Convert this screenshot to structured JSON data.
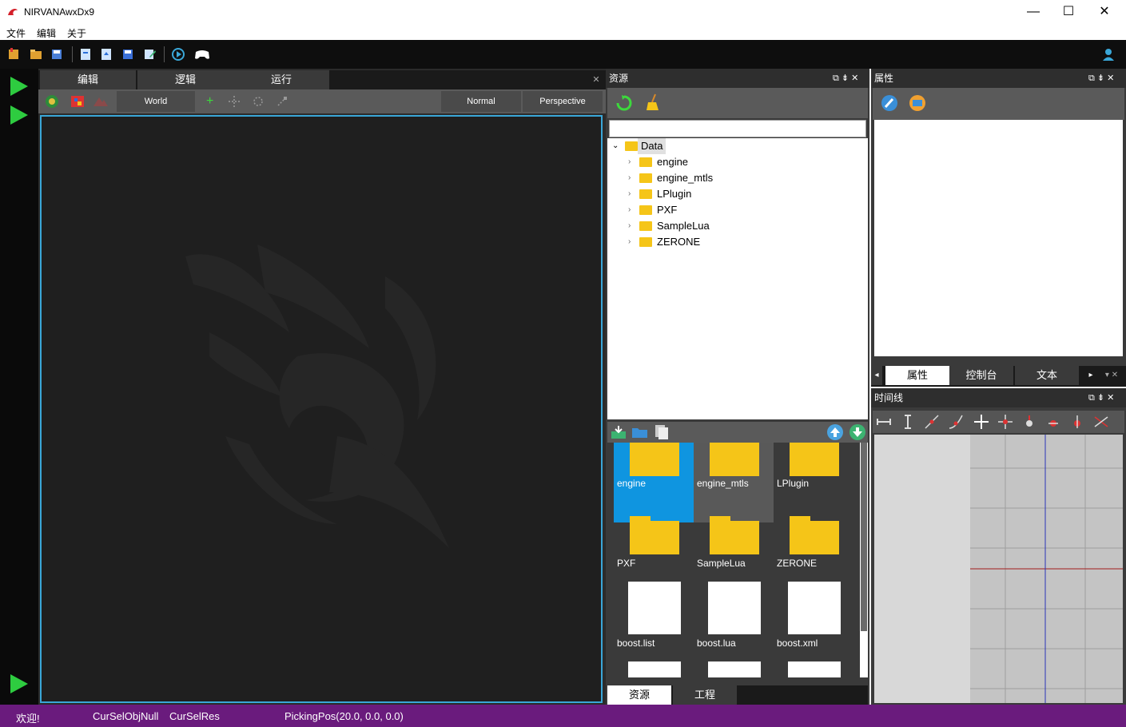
{
  "window": {
    "title": "NIRVANAwxDx9",
    "min": "—",
    "max": "☐",
    "close": "✕"
  },
  "menu": {
    "file": "文件",
    "edit": "编辑",
    "about": "关于"
  },
  "editor": {
    "tabs": [
      "编辑",
      "逻辑",
      "运行"
    ],
    "close": "✕",
    "world": "World",
    "plus": "+",
    "normal": "Normal",
    "perspective": "Perspective"
  },
  "resources": {
    "title": "资源",
    "dock_controls": "⧉ ⇟ ✕",
    "search_placeholder": "",
    "tree_root": "Data",
    "tree_items": [
      "engine",
      "engine_mtls",
      "LPlugin",
      "PXF",
      "SampleLua",
      "ZERONE"
    ],
    "tiles": [
      {
        "label": "engine",
        "kind": "folder"
      },
      {
        "label": "engine_mtls",
        "kind": "folder"
      },
      {
        "label": "LPlugin",
        "kind": "folder"
      },
      {
        "label": "PXF",
        "kind": "folder"
      },
      {
        "label": "SampleLua",
        "kind": "folder"
      },
      {
        "label": "ZERONE",
        "kind": "folder"
      },
      {
        "label": "boost.list",
        "kind": "file"
      },
      {
        "label": "boost.lua",
        "kind": "file"
      },
      {
        "label": "boost.xml",
        "kind": "file"
      }
    ],
    "bottom_tabs": [
      "资源",
      "工程"
    ]
  },
  "properties": {
    "title": "属性",
    "dock_controls": "⧉ ⇟ ✕",
    "tabs": [
      "属性",
      "控制台",
      "文本"
    ]
  },
  "timeline": {
    "title": "时间线",
    "dock_controls": "⧉ ⇟ ✕"
  },
  "status": {
    "welcome": "欢迎!",
    "cur_sel_obj": "CurSelObjNull",
    "cur_sel_res": "CurSelRes",
    "picking_pos": "PickingPos(20.0, 0.0, 0.0)"
  },
  "colors": {
    "accent_blue": "#3aa7d8",
    "selection_blue": "#0f95e0",
    "folder_yellow": "#f5c518",
    "status_purple": "#6a1b7d",
    "play_green": "#2ecc40"
  }
}
